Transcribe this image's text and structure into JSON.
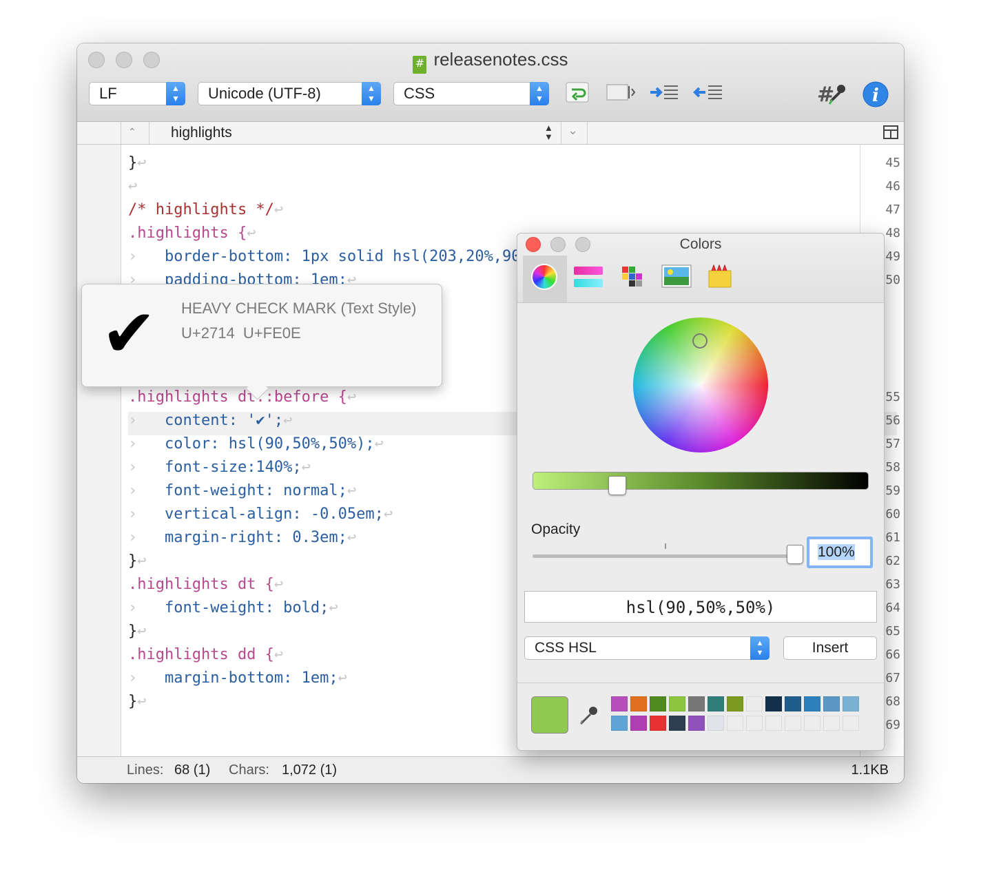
{
  "window": {
    "title": "releasenotes.css"
  },
  "toolbar": {
    "line_ending": "LF",
    "encoding": "Unicode (UTF-8)",
    "syntax": "CSS",
    "icons": [
      "wrap-lines-icon",
      "invisibles-icon",
      "shift-right-icon",
      "shift-left-icon",
      "color-code-icon",
      "info-icon"
    ]
  },
  "navigation": {
    "outline_item": "highlights"
  },
  "editor": {
    "lines": [
      {
        "n": "45",
        "text": "}"
      },
      {
        "n": "46",
        "text": ""
      },
      {
        "n": "47",
        "text": "/* highlights */"
      },
      {
        "n": "48",
        "text": ".highlights {"
      },
      {
        "n": "49",
        "text": "border-bottom: 1px solid hsl(203,20%,90"
      },
      {
        "n": "50",
        "text": "padding-bottom: 1em;"
      },
      {
        "n": "55",
        "text": ".highlights dt::before {"
      },
      {
        "n": "56",
        "text": "content: '✔';"
      },
      {
        "n": "57",
        "text": "color: hsl(90,50%,50%);"
      },
      {
        "n": "58",
        "text": "font-size:140%;"
      },
      {
        "n": "59",
        "text": "font-weight: normal;"
      },
      {
        "n": "60",
        "text": "vertical-align: -0.05em;"
      },
      {
        "n": "61",
        "text": "margin-right: 0.3em;"
      },
      {
        "n": "62",
        "text": "}"
      },
      {
        "n": "63",
        "text": ".highlights dt {"
      },
      {
        "n": "64",
        "text": "font-weight: bold;"
      },
      {
        "n": "65",
        "text": "}"
      },
      {
        "n": "66",
        "text": ".highlights dd {"
      },
      {
        "n": "67",
        "text": "margin-bottom: 1em;"
      },
      {
        "n": "68",
        "text": "}"
      },
      {
        "n": "69",
        "text": ""
      }
    ]
  },
  "char_popover": {
    "glyph": "✔",
    "name": "HEAVY CHECK MARK (Text Style)",
    "codepoints": "U+2714  U+FE0E"
  },
  "status": {
    "lines_label": "Lines:",
    "lines_value": "68 (1)",
    "chars_label": "Chars:",
    "chars_value": "1,072 (1)",
    "size": "1.1KB"
  },
  "colors_panel": {
    "title": "Colors",
    "opacity_label": "Opacity",
    "opacity_value": "100%",
    "color_code": "hsl(90,50%,50%)",
    "format": "CSS HSL",
    "insert_label": "Insert",
    "current_color": "#8fc94f",
    "brightness_level": 0.25,
    "opacity_level": 1.0,
    "palette": [
      "#b64fba",
      "#e0701f",
      "#4f8a1f",
      "#8cc63f",
      "#777777",
      "#2f7f78",
      "#7b9a1f",
      "#ececec",
      "#12304a",
      "#1f5d8a",
      "#2c80bc",
      "#5b97c4",
      "#7ab0d3",
      "#5fa4d6",
      "#b03fb4",
      "#e63232",
      "#2c3e50",
      "#8f52ba",
      "#e0e4e8",
      "#ededed",
      "#ededed",
      "#ededed",
      "#ededed",
      "#ededed",
      "#ededed",
      "#ededed"
    ]
  }
}
